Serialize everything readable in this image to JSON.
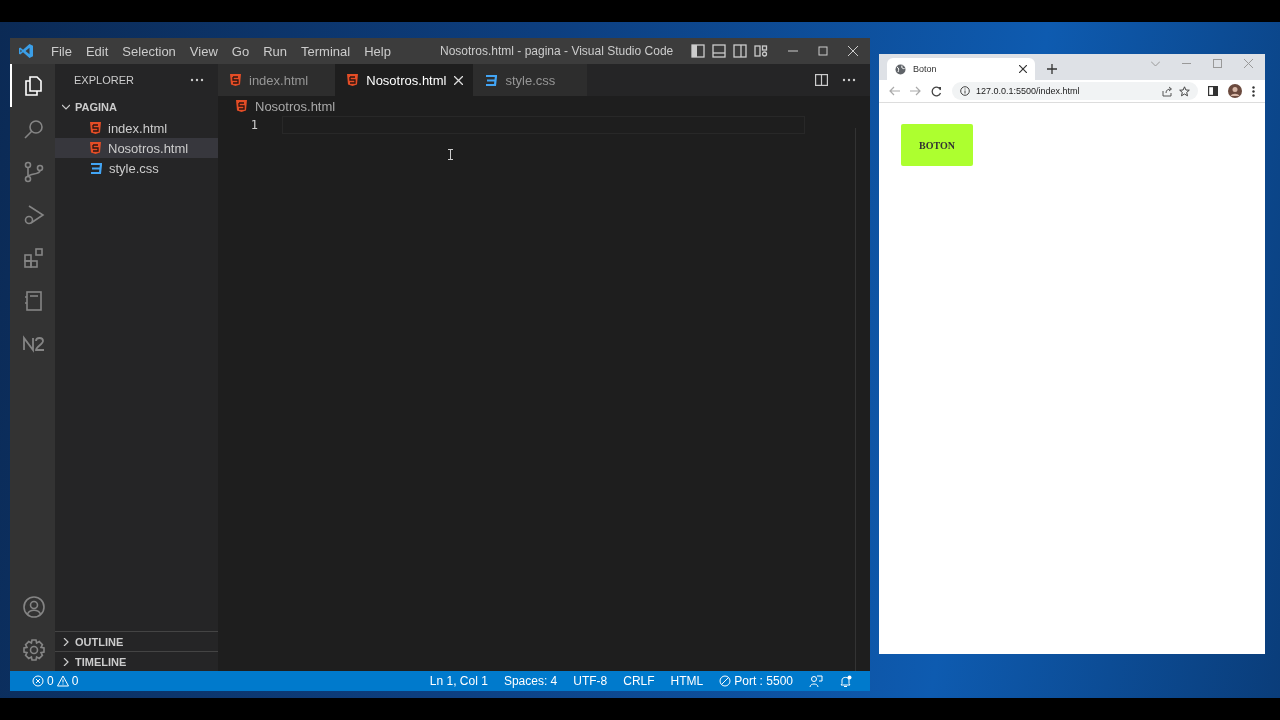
{
  "vscode": {
    "menu": [
      "File",
      "Edit",
      "Selection",
      "View",
      "Go",
      "Run",
      "Terminal",
      "Help"
    ],
    "title": "Nosotros.html - pagina - Visual Studio Code",
    "activity": [
      {
        "kind": "files",
        "selected": true
      },
      {
        "kind": "search",
        "selected": false
      },
      {
        "kind": "source",
        "selected": false
      },
      {
        "kind": "debug",
        "selected": false
      },
      {
        "kind": "extensions",
        "selected": false
      },
      {
        "kind": "notebook",
        "selected": false
      },
      {
        "kind": "n2",
        "selected": false
      }
    ],
    "explorer": {
      "title": "EXPLORER",
      "folder": "PAGINA",
      "expanded": true,
      "files": [
        {
          "name": "index.html",
          "kind": "html",
          "selected": false
        },
        {
          "name": "Nosotros.html",
          "kind": "html",
          "selected": true
        },
        {
          "name": "style.css",
          "kind": "css",
          "selected": false
        }
      ]
    },
    "tabs": [
      {
        "name": "index.html",
        "kind": "html",
        "selected": false
      },
      {
        "name": "Nosotros.html",
        "kind": "html",
        "selected": true
      },
      {
        "name": "style.css",
        "kind": "css",
        "selected": false
      }
    ],
    "breadcrumb": {
      "name": "Nosotros.html",
      "kind": "html"
    },
    "line_numbers": [
      "1"
    ],
    "panels": [
      {
        "title": "OUTLINE",
        "expanded": false
      },
      {
        "title": "TIMELINE",
        "expanded": false
      }
    ],
    "status_bar": {
      "errors": "0",
      "warnings": "0",
      "items": [
        {
          "text": "Ln 1, Col 1",
          "kind": "text"
        },
        {
          "text": "Spaces: 4",
          "kind": "text"
        },
        {
          "text": "UTF-8",
          "kind": "text"
        },
        {
          "text": "CRLF",
          "kind": "text"
        },
        {
          "text": "HTML",
          "kind": "text"
        },
        {
          "text": "Port : 5500",
          "kind": "port"
        }
      ]
    }
  },
  "browser": {
    "tab_title": "Boton",
    "url": "127.0.0.1:5500/index.html",
    "page_button": "BOTON"
  }
}
